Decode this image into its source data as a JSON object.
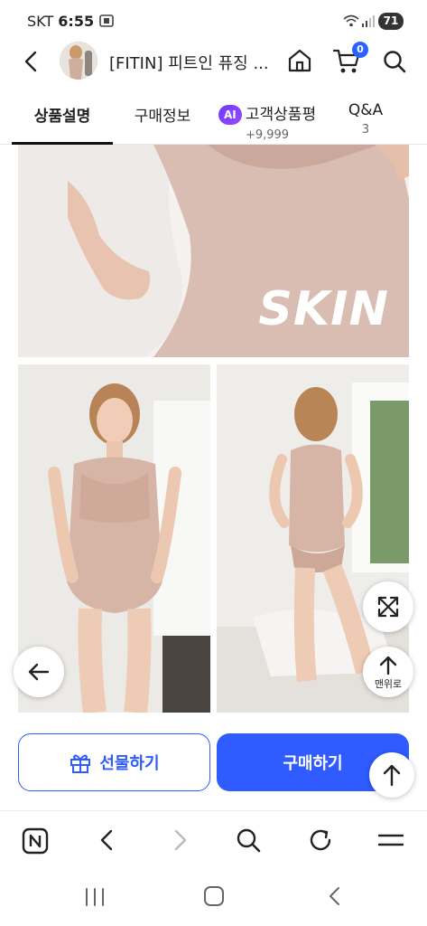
{
  "status": {
    "carrier": "SKT",
    "time": "6:55",
    "battery": "71"
  },
  "header": {
    "title": "[FITIN] 피트인 퓨징 ...",
    "cart_count": "0"
  },
  "tabs": [
    {
      "label": "상품설명",
      "sub": ""
    },
    {
      "label": "구매정보",
      "sub": ""
    },
    {
      "label": "고객상품평",
      "sub": "+9,999",
      "ai": "AI"
    },
    {
      "label": "Q&A",
      "sub": "3"
    }
  ],
  "product": {
    "overlay_text": "SKIN"
  },
  "floating": {
    "top_label": "맨위로"
  },
  "actions": {
    "gift_label": "선물하기",
    "buy_label": "구매하기"
  },
  "colors": {
    "accent": "#2f5bff",
    "ai": "#7a40ff"
  }
}
